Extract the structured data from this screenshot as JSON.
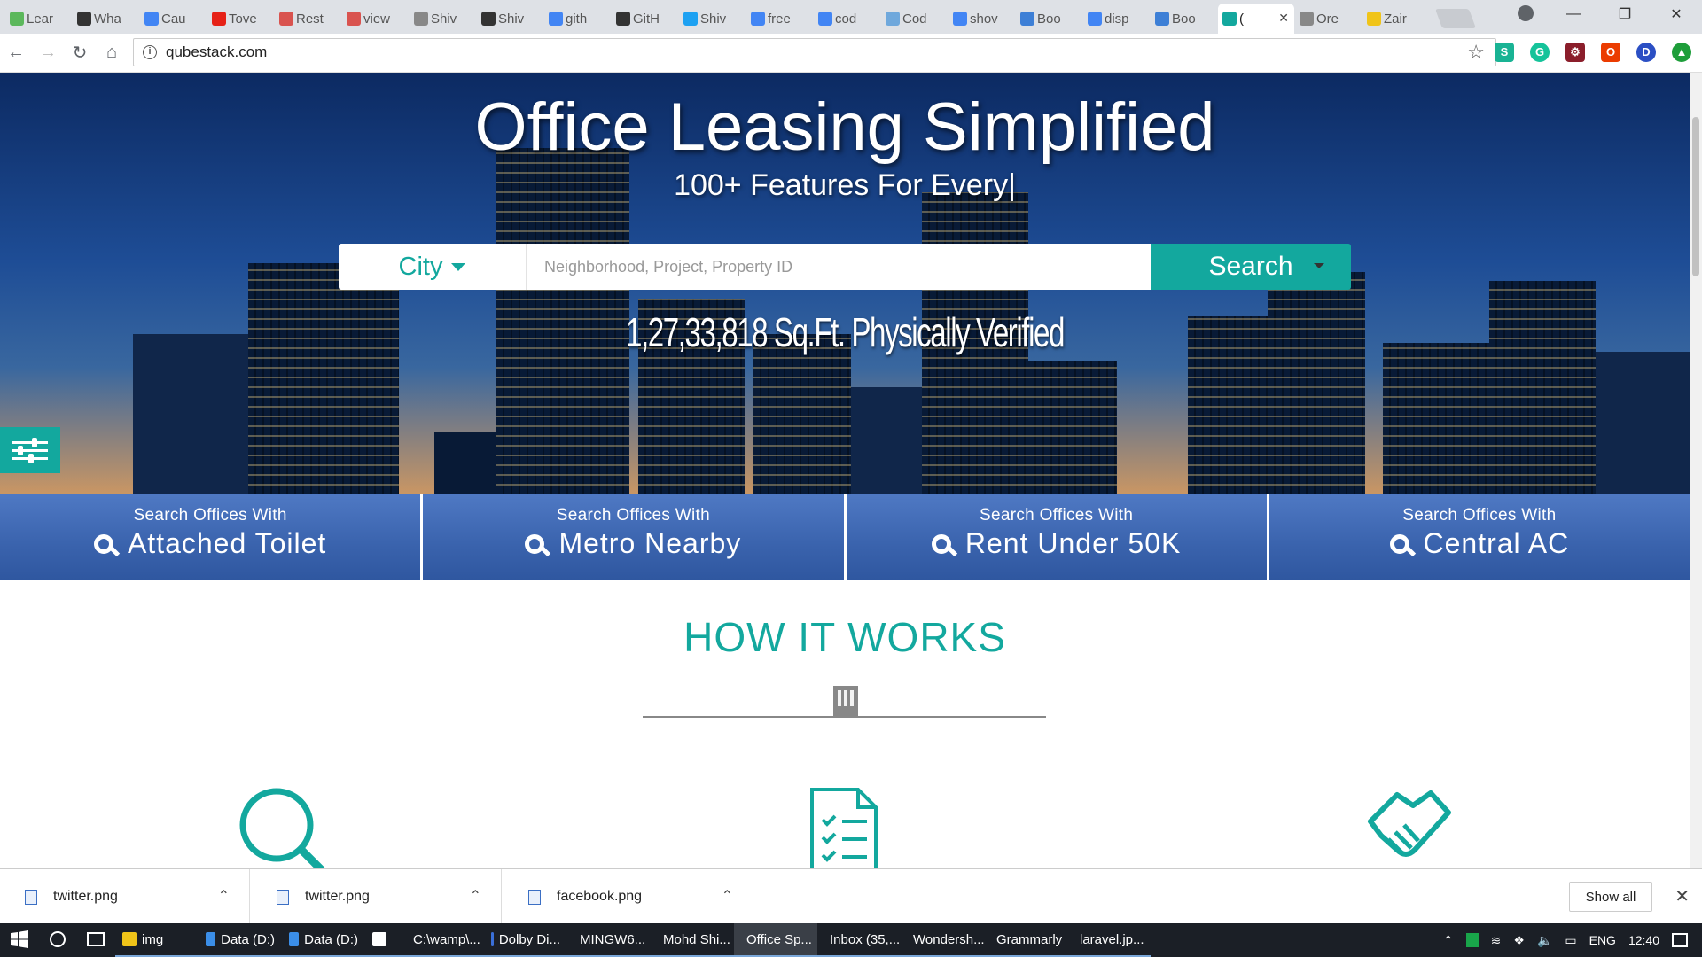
{
  "browser": {
    "tabs": [
      {
        "label": "Lear",
        "icon": "u-icon",
        "color": "#5cb85c"
      },
      {
        "label": "Wha",
        "icon": "nyt-icon",
        "color": "#333333"
      },
      {
        "label": "Cau",
        "icon": "google-icon",
        "color": "#4285f4"
      },
      {
        "label": "Tove",
        "icon": "youtube-icon",
        "color": "#e62117"
      },
      {
        "label": "Rest",
        "icon": "red-icon",
        "color": "#d9534f"
      },
      {
        "label": "view",
        "icon": "red-icon",
        "color": "#d9534f"
      },
      {
        "label": "Shiv",
        "icon": "page-icon",
        "color": "#888888"
      },
      {
        "label": "Shiv",
        "icon": "github-icon",
        "color": "#333333"
      },
      {
        "label": "gith",
        "icon": "google-icon",
        "color": "#4285f4"
      },
      {
        "label": "GitH",
        "icon": "github-icon",
        "color": "#333333"
      },
      {
        "label": "Shiv",
        "icon": "twitter-icon",
        "color": "#1da1f2"
      },
      {
        "label": "free",
        "icon": "google-icon",
        "color": "#4285f4"
      },
      {
        "label": "cod",
        "icon": "google-icon",
        "color": "#4285f4"
      },
      {
        "label": "Cod",
        "icon": "cv-icon",
        "color": "#6fa8dc"
      },
      {
        "label": "shov",
        "icon": "google-icon",
        "color": "#4285f4"
      },
      {
        "label": "Boo",
        "icon": "b-icon",
        "color": "#3d7fd6"
      },
      {
        "label": "disp",
        "icon": "google-icon",
        "color": "#4285f4"
      },
      {
        "label": "Boo",
        "icon": "b-icon",
        "color": "#3d7fd6"
      },
      {
        "label": "(",
        "icon": "qubestack-icon",
        "color": "#13a89e",
        "active": true
      },
      {
        "label": "Ore",
        "icon": "page-icon",
        "color": "#888888"
      },
      {
        "label": "Zair",
        "icon": "bulb-icon",
        "color": "#f0c419"
      }
    ],
    "url": "qubestack.com"
  },
  "hero": {
    "title": "Office Leasing Simplified",
    "subtitle": "100+ Features For Every|",
    "city_label": "City",
    "search_placeholder": "Neighborhood, Project, Property ID",
    "search_button": "Search",
    "verified_text": "1,27,33,818 Sq.Ft. Physically Verified"
  },
  "quick_search": [
    {
      "small": "Search Offices With",
      "big": "Attached Toilet"
    },
    {
      "small": "Search Offices With",
      "big": "Metro Nearby"
    },
    {
      "small": "Search Offices With",
      "big": "Rent Under 50K"
    },
    {
      "small": "Search Offices With",
      "big": "Central AC"
    }
  ],
  "how_it_works": {
    "heading": "HOW IT WORKS"
  },
  "downloads": {
    "items": [
      "twitter.png",
      "twitter.png",
      "facebook.png"
    ],
    "show_all": "Show all"
  },
  "taskbar": {
    "items": [
      {
        "label": "img",
        "icon": "folder-icon",
        "color": "#f0c419"
      },
      {
        "label": "Data (D:)",
        "icon": "ie-icon",
        "color": "#3b8ee8"
      },
      {
        "label": "Data (D:)",
        "icon": "ie-icon",
        "color": "#3b8ee8"
      },
      {
        "label": "",
        "icon": "store-icon",
        "color": "#ffffff"
      },
      {
        "label": "C:\\wamp\\...",
        "icon": "explorer-icon",
        "color": "#999999"
      },
      {
        "label": "Dolby Di...",
        "icon": "dolby-icon",
        "color": "#3a6fd8"
      },
      {
        "label": "MINGW6...",
        "icon": "terminal-icon",
        "color": "#555555"
      },
      {
        "label": "Mohd Shi...",
        "icon": "chrome-icon",
        "color": "#db4437"
      },
      {
        "label": "Office Sp...",
        "icon": "chrome-icon",
        "color": "#db4437",
        "active": true
      },
      {
        "label": "Inbox (35,...",
        "icon": "chrome-icon",
        "color": "#db4437"
      },
      {
        "label": "Wondersh...",
        "icon": "wondershare-icon",
        "color": "#3a8ee6"
      },
      {
        "label": "Grammarly",
        "icon": "grammarly-icon",
        "color": "#15c39a"
      },
      {
        "label": "laravel.jp...",
        "icon": "paint-icon",
        "color": "#7bb661"
      }
    ],
    "tray": {
      "lang": "ENG",
      "time": "12:40"
    }
  }
}
